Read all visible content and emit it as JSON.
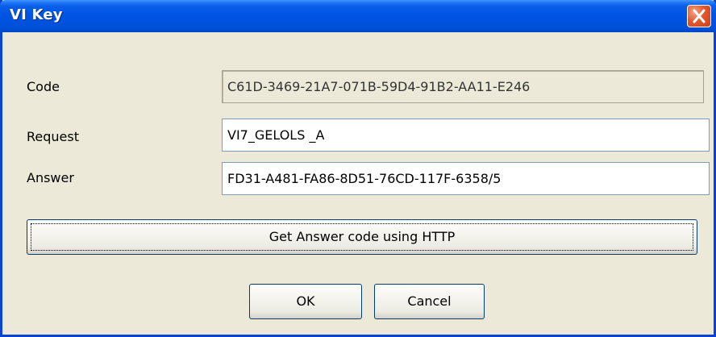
{
  "window": {
    "title": "VI Key"
  },
  "fields": {
    "code": {
      "label": "Code",
      "value": "C61D-3469-21A7-071B-59D4-91B2-AA11-E246"
    },
    "request": {
      "label": "Request",
      "value": "VI7_GELOLS _A"
    },
    "answer": {
      "label": "Answer",
      "value": "FD31-A481-FA86-8D51-76CD-117F-6358/5"
    }
  },
  "buttons": {
    "http_label": "Get Answer code using HTTP",
    "ok_label": "OK",
    "cancel_label": "Cancel"
  },
  "icons": {
    "close": "close-icon"
  },
  "colors": {
    "titlebar": "#0054e3",
    "close_button": "#e2582e",
    "dialog_background": "#ece9d8"
  }
}
